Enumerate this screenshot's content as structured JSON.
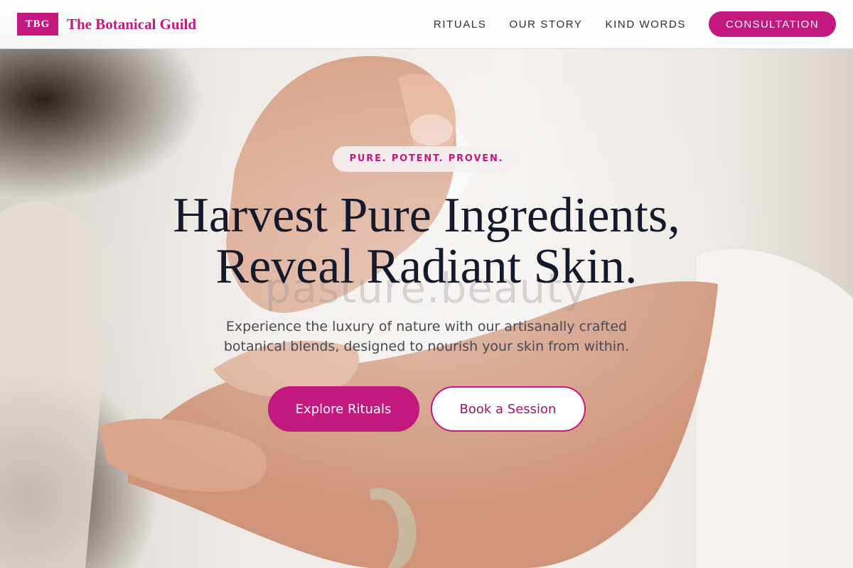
{
  "header": {
    "logo_text": "TBG",
    "brand_name": "The Botanical Guild",
    "nav": [
      "RITUALS",
      "OUR STORY",
      "KIND WORDS"
    ],
    "cta_label": "CONSULTATION"
  },
  "hero": {
    "tagline": "PURE. POTENT. PROVEN.",
    "headline_line1": "Harvest Pure Ingredients,",
    "headline_line2": "Reveal Radiant Skin.",
    "watermark": "pasture.beauty",
    "subtitle_line1": "Experience the luxury of nature with our artisanally crafted",
    "subtitle_line2": "botanical blends, designed to nourish your skin from within.",
    "primary_button": "Explore Rituals",
    "secondary_button": "Book a Session"
  },
  "colors": {
    "accent": "#c2187f",
    "headline": "#141a2c",
    "body_text": "#4a4a55"
  }
}
